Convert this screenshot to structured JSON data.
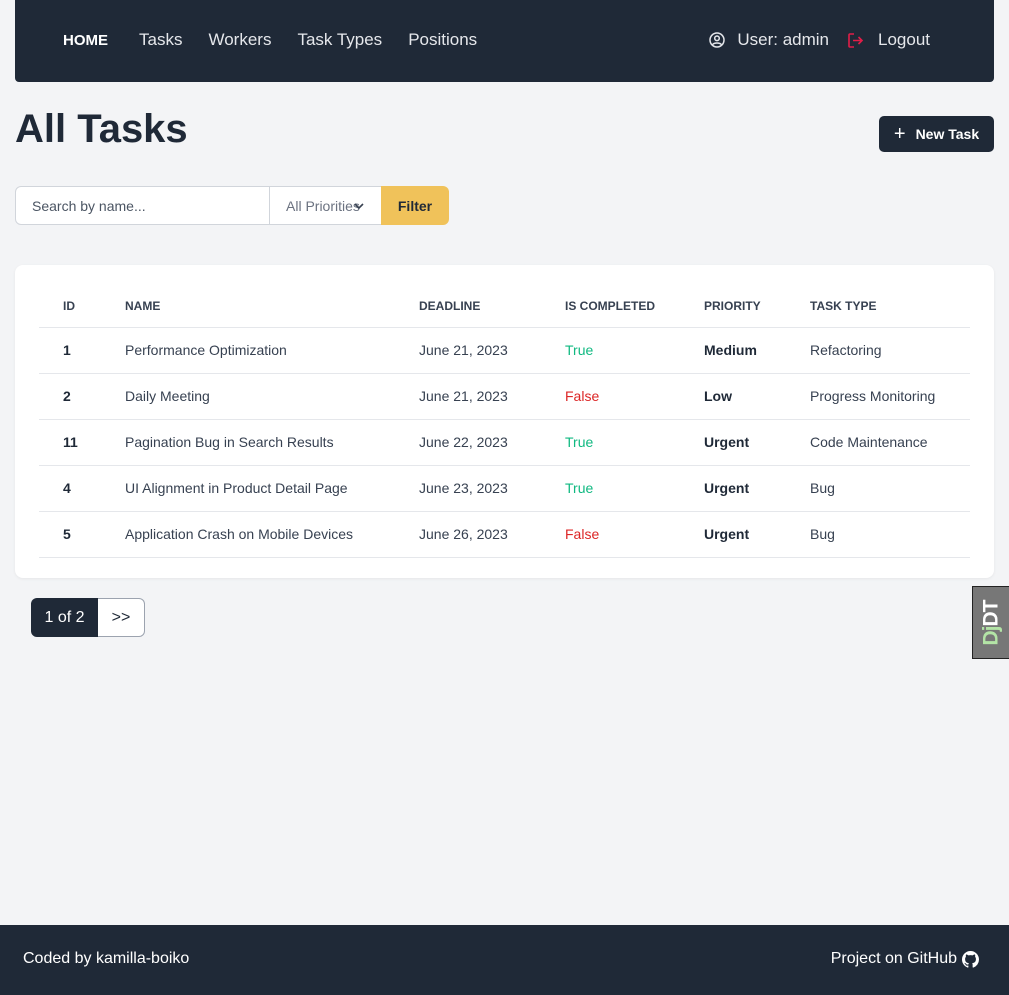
{
  "nav": {
    "home": "HOME",
    "links": [
      "Tasks",
      "Workers",
      "Task Types",
      "Positions"
    ],
    "user": "User: admin",
    "logout": "Logout"
  },
  "page": {
    "title": "All Tasks",
    "new_task_label": "New Task"
  },
  "filters": {
    "search_placeholder": "Search by name...",
    "priority_selected": "All Priorities",
    "filter_label": "Filter"
  },
  "table": {
    "headers": [
      "ID",
      "NAME",
      "DEADLINE",
      "IS COMPLETED",
      "PRIORITY",
      "TASK TYPE"
    ],
    "rows": [
      {
        "id": "1",
        "name": "Performance Optimization",
        "deadline": "June 21, 2023",
        "completed": "True",
        "priority": "Medium",
        "type": "Refactoring"
      },
      {
        "id": "2",
        "name": "Daily Meeting",
        "deadline": "June 21, 2023",
        "completed": "False",
        "priority": "Low",
        "type": "Progress Monitoring"
      },
      {
        "id": "11",
        "name": "Pagination Bug in Search Results",
        "deadline": "June 22, 2023",
        "completed": "True",
        "priority": "Urgent",
        "type": "Code Maintenance"
      },
      {
        "id": "4",
        "name": "UI Alignment in Product Detail Page",
        "deadline": "June 23, 2023",
        "completed": "True",
        "priority": "Urgent",
        "type": "Bug"
      },
      {
        "id": "5",
        "name": "Application Crash on Mobile Devices",
        "deadline": "June 26, 2023",
        "completed": "False",
        "priority": "Urgent",
        "type": "Bug"
      }
    ]
  },
  "pagination": {
    "current": "1 of 2",
    "next": ">>"
  },
  "djdt": {
    "dj": "Dj",
    "dt": "DT"
  },
  "footer": {
    "credit": "Coded by kamilla-boiko",
    "github": "Project on GitHub"
  },
  "colors": {
    "navbar": "#1f2937",
    "background": "#f3f4f6",
    "filter_button": "#f0c25a",
    "status_true": "#10b981",
    "status_false": "#dc2626",
    "logout_icon": "#e11d48"
  }
}
